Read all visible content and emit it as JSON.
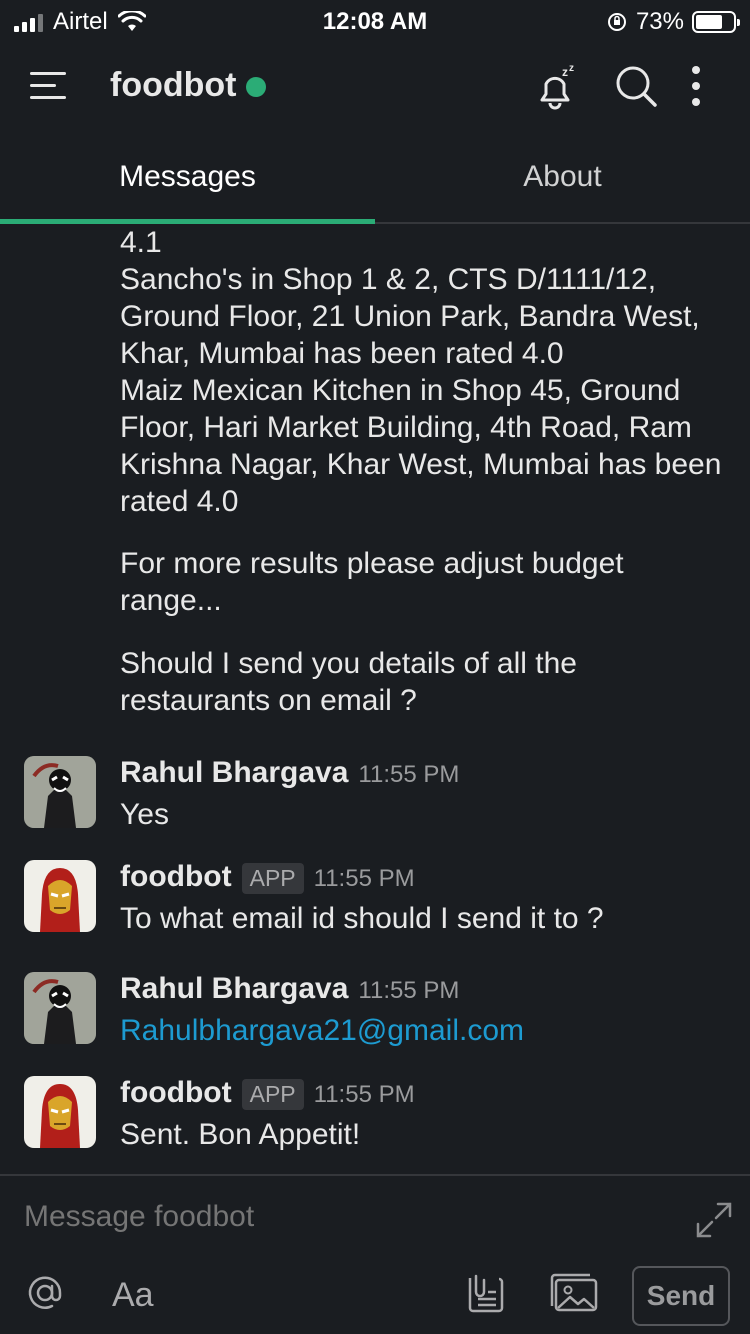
{
  "status_bar": {
    "carrier": "Airtel",
    "time": "12:08 AM",
    "battery_percent": "73%",
    "battery_level": 0.73
  },
  "header": {
    "title": "foodbot",
    "presence_color": "#2bac76",
    "icons": [
      "menu-icon",
      "snooze-bell-icon",
      "search-icon",
      "more-vertical-icon"
    ]
  },
  "tabs": [
    {
      "label": "Messages",
      "active": true
    },
    {
      "label": "About",
      "active": false
    }
  ],
  "bot_continuation": {
    "paragraph_1": "4.1\nSancho's in Shop 1 & 2, CTS D/1111/12, Ground Floor, 21 Union Park, Bandra West, Khar, Mumbai has been rated 4.0\nMaiz Mexican Kitchen in Shop 45, Ground Floor, Hari Market Building, 4th Road, Ram Krishna Nagar, Khar West, Mumbai has been rated 4.0",
    "paragraph_2": "For more results please adjust budget range...",
    "paragraph_3": "Should I send you details of all the restaurants on email ?"
  },
  "messages": [
    {
      "sender": "Rahul Bhargava",
      "badge": "",
      "time": "11:55 PM",
      "text": "Yes"
    },
    {
      "sender": "foodbot",
      "badge": "APP",
      "time": "11:55 PM",
      "text": "To what email id should I send it to ?"
    },
    {
      "sender": "Rahul Bhargava",
      "badge": "",
      "time": "11:55 PM",
      "text": "Rahulbhargava21@gmail.com"
    },
    {
      "sender": "foodbot",
      "badge": "APP",
      "time": "11:55 PM",
      "text": "Sent. Bon Appetit!"
    }
  ],
  "composer": {
    "placeholder": "Message foodbot",
    "format_label": "Aa",
    "send_label": "Send"
  },
  "colors": {
    "background": "#1a1d21",
    "accent": "#2bac76",
    "link": "#1d9bd1"
  }
}
